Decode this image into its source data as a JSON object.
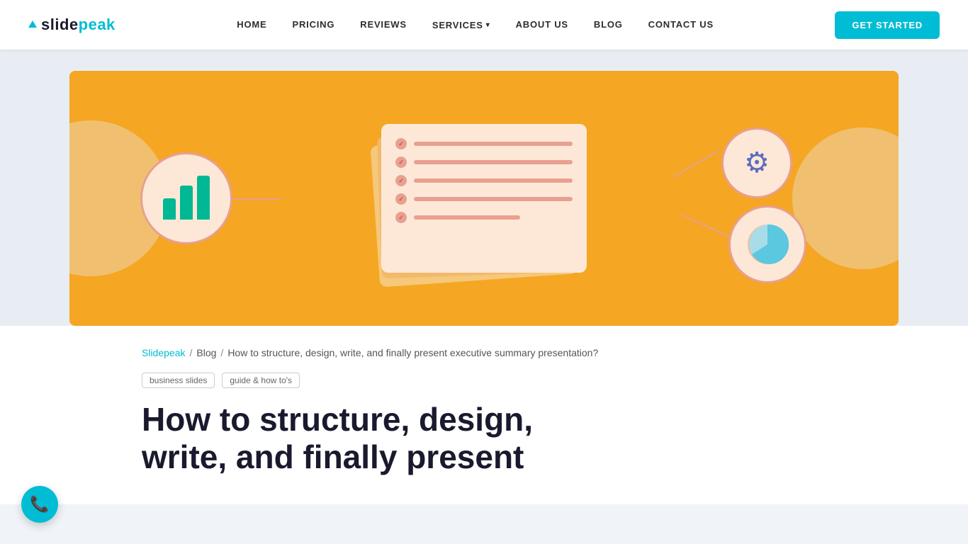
{
  "brand": {
    "name_slide": "slide",
    "name_peak": "peak",
    "logo_alt": "SlidePeak logo"
  },
  "navbar": {
    "links": [
      {
        "id": "home",
        "label": "HOME"
      },
      {
        "id": "pricing",
        "label": "PRICING"
      },
      {
        "id": "reviews",
        "label": "REVIEWS"
      },
      {
        "id": "services",
        "label": "SERVICES",
        "has_dropdown": true
      },
      {
        "id": "about",
        "label": "ABOUT US"
      },
      {
        "id": "blog",
        "label": "BLOG"
      },
      {
        "id": "contact",
        "label": "CONTACT US"
      }
    ],
    "cta_label": "GET STARTED"
  },
  "breadcrumb": {
    "home_label": "Slidepeak",
    "sep1": "/",
    "blog_label": "Blog",
    "sep2": "/",
    "current": "How to structure, design, write, and finally present executive summary presentation?"
  },
  "tags": [
    {
      "label": "business slides"
    },
    {
      "label": "guide & how to's"
    }
  ],
  "article": {
    "title_line1": "How to structure, design,",
    "title_line2": "write, and finally present"
  },
  "illustration": {
    "bars": [
      30,
      50,
      65
    ],
    "gear_symbol": "⚙",
    "phone_icon": "📞"
  }
}
